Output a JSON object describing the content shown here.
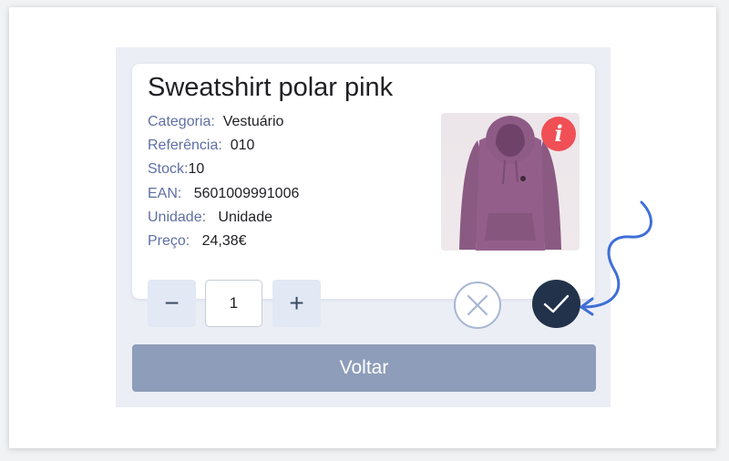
{
  "product": {
    "name": "Sweatshirt polar pink",
    "fields": [
      {
        "label": "Categoria:",
        "value": "Vestuário"
      },
      {
        "label": "Referência:",
        "value": "010"
      },
      {
        "label": "Stock:",
        "value": "10"
      },
      {
        "label": "EAN:",
        "value": "5601009991006"
      },
      {
        "label": "Unidade:",
        "value": "Unidade"
      },
      {
        "label": "Preço:",
        "value": "24,38€"
      }
    ],
    "image_icon": "hoodie-photo",
    "info_icon": "info-icon",
    "info_glyph": "i"
  },
  "quantity": {
    "minus_label": "−",
    "value": "1",
    "plus_label": "+"
  },
  "actions": {
    "cancel_icon": "close-icon",
    "confirm_icon": "checkmark-icon"
  },
  "back_label": "Voltar",
  "colors": {
    "label": "#5f6fa3",
    "info": "#ef4f55",
    "confirm": "#22324a",
    "back": "#8e9db9",
    "annotation_arrow": "#3f6fd6",
    "product_color": "#8f5e86"
  }
}
